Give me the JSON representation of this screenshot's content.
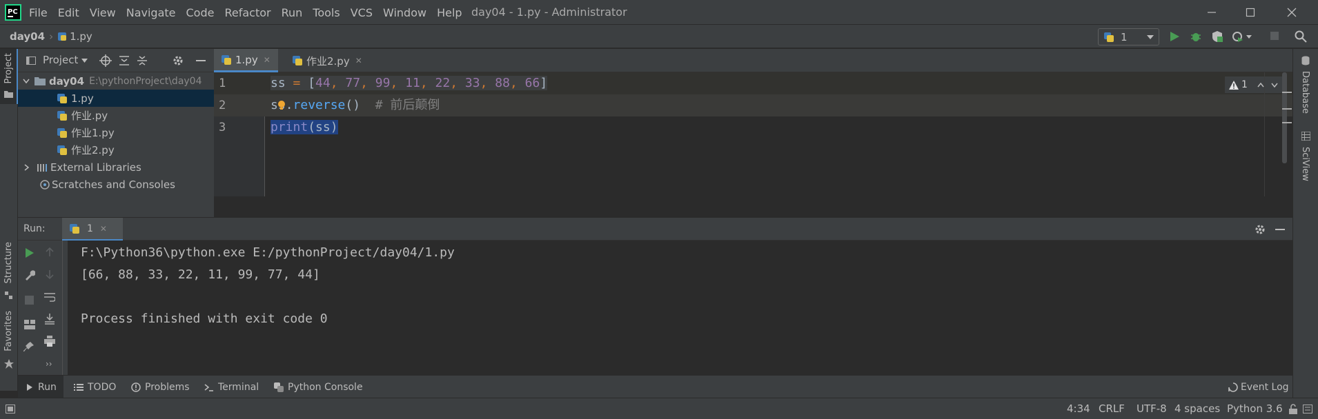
{
  "window": {
    "title": "day04 - 1.py - Administrator",
    "menu": [
      "File",
      "Edit",
      "View",
      "Navigate",
      "Code",
      "Refactor",
      "Run",
      "Tools",
      "VCS",
      "Window",
      "Help"
    ]
  },
  "navbar": {
    "project": "day04",
    "file": "1.py",
    "run_config": "1"
  },
  "left_stripe": {
    "project_label": "Project",
    "structure_label": "Structure",
    "favorites_label": "Favorites"
  },
  "project_panel": {
    "title": "Project",
    "root_name": "day04",
    "root_path": "E:\\pythonProject\\day04",
    "files": [
      "1.py",
      "作业.py",
      "作业1.py",
      "作业2.py"
    ],
    "external_libraries": "External Libraries",
    "scratches": "Scratches and Consoles"
  },
  "editor": {
    "tabs": [
      "1.py",
      "作业2.py"
    ],
    "line_numbers": [
      "1",
      "2",
      "3"
    ],
    "code": {
      "l1_var": "ss",
      "l1_op": " = ",
      "l1_open": "[",
      "l1_nums": [
        "44",
        "77",
        "99",
        "11",
        "22",
        "33",
        "88",
        "66"
      ],
      "l1_sep": ", ",
      "l1_close": "]",
      "l2_var": "ss",
      "l2_dot": ".",
      "l2_method": "reverse",
      "l2_parens": "()",
      "l2_comment": "  # 前后颠倒",
      "l3_fn": "print",
      "l3_args": "(ss)"
    },
    "inspection_count": "1"
  },
  "run_panel": {
    "label": "Run:",
    "tab": "1",
    "output": [
      "F:\\Python36\\python.exe E:/pythonProject/day04/1.py",
      "[66, 88, 33, 22, 11, 99, 77, 44]",
      "",
      "Process finished with exit code 0"
    ]
  },
  "tool_tabs": [
    "Run",
    "TODO",
    "Problems",
    "Terminal",
    "Python Console"
  ],
  "event_log": "Event Log",
  "status_bar": {
    "position": "4:34",
    "line_sep": "CRLF",
    "encoding": "UTF-8",
    "indent": "4 spaces",
    "interpreter": "Python 3.6"
  },
  "right_stripe": {
    "database": "Database",
    "sciview": "SciView"
  },
  "colors": {
    "accent": "#4a88c7",
    "run_green": "#499c54",
    "selection": "#0d293e",
    "highlight_line": "#323232"
  }
}
